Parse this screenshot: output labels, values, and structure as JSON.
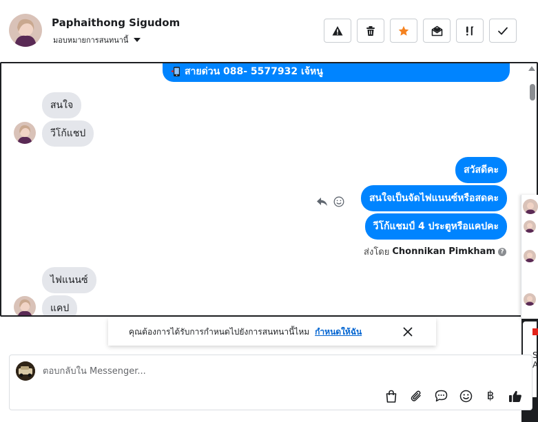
{
  "contact": {
    "name": "Paphaithong Sigudom",
    "assign_label": "มอบหมายการสนทนานี้"
  },
  "toolbar": {
    "buttons": [
      {
        "icon": "warning-icon"
      },
      {
        "icon": "trash-icon"
      },
      {
        "icon": "star-icon",
        "color": "#f5821f"
      },
      {
        "icon": "mark-unread-icon"
      },
      {
        "icon": "urgent-icon"
      },
      {
        "icon": "done-check-icon"
      }
    ]
  },
  "chat": {
    "pinned_text": "สายด่วน 088- 5577932 เจ้หนู",
    "incoming_group_1": [
      "สนใจ",
      "วีโก้แชป"
    ],
    "outgoing": [
      "สวัสดีคะ",
      "สนใจเป็นจัดไฟแนนซ์หรือสดคะ",
      "วีโก้แชมป์ 4 ประตูหรือแคปคะ"
    ],
    "sent_by_prefix": "ส่งโดย",
    "sent_by_name": "Chonnikan Pimkham",
    "incoming_group_2": [
      "ไฟแนนซ์",
      "แคป"
    ]
  },
  "notice": {
    "text": "คุณต้องการได้รับการกำหนดไปยังการสนทนานี้ไหม",
    "link": "กำหนดให้ฉัน"
  },
  "composer": {
    "placeholder": "ตอบกลับใน Messenger...",
    "currency_symbol": "฿"
  },
  "side_panel": {
    "letters": [
      "S",
      "A"
    ]
  },
  "colors": {
    "brand_blue": "#0084ff",
    "incoming_bubble": "#e4e6eb",
    "star_orange": "#f5821f",
    "link_blue": "#0064d1"
  }
}
